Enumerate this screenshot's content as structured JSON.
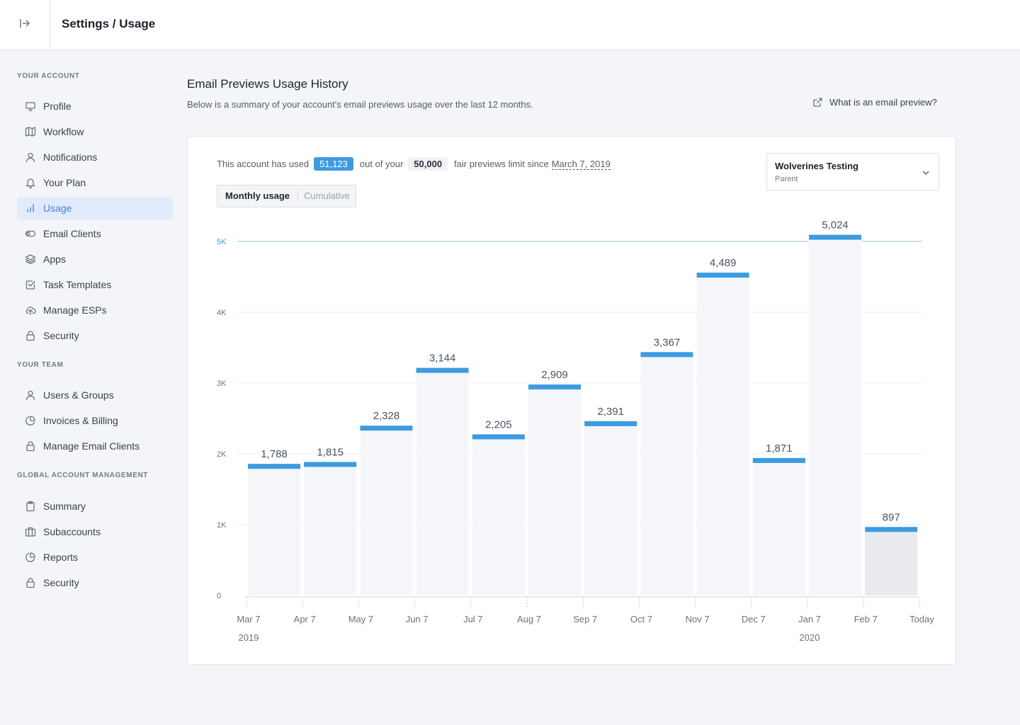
{
  "header": {
    "breadcrumb": "Settings / Usage"
  },
  "sidebar": {
    "sections": [
      {
        "title": "Your Account",
        "items": [
          {
            "label": "Profile",
            "icon": "monitor-icon"
          },
          {
            "label": "Workflow",
            "icon": "map-icon"
          },
          {
            "label": "Notifications",
            "icon": "user-icon"
          },
          {
            "label": "Your Plan",
            "icon": "bell-icon"
          },
          {
            "label": "Usage",
            "icon": "bar-chart-icon",
            "active": true
          },
          {
            "label": "Email Clients",
            "icon": "toggle-icon"
          },
          {
            "label": "Apps",
            "icon": "layers-icon"
          },
          {
            "label": "Task Templates",
            "icon": "checkbox-icon"
          },
          {
            "label": "Manage ESPs",
            "icon": "cloud-upload-icon"
          },
          {
            "label": "Security",
            "icon": "lock-icon"
          }
        ]
      },
      {
        "title": "Your Team",
        "items": [
          {
            "label": "Users & Groups",
            "icon": "user-icon"
          },
          {
            "label": "Invoices & Billing",
            "icon": "pie-chart-icon"
          },
          {
            "label": "Manage Email Clients",
            "icon": "lock-icon"
          }
        ]
      },
      {
        "title": "Global Account Management",
        "items": [
          {
            "label": "Summary",
            "icon": "clipboard-icon"
          },
          {
            "label": "Subaccounts",
            "icon": "briefcase-icon"
          },
          {
            "label": "Reports",
            "icon": "pie-chart-icon"
          },
          {
            "label": "Security",
            "icon": "lock-icon"
          }
        ]
      }
    ]
  },
  "main": {
    "title": "Email Previews Usage History",
    "subtitle": "Below is a summary of your account's email previews usage over the last 12 months.",
    "help_link": "What is an email preview?"
  },
  "summary": {
    "prefix": "This account has used",
    "used": "51,123",
    "middle": "out of your",
    "limit": "50,000",
    "suffix": "fair previews limit since",
    "since": "March 7, 2019"
  },
  "toggle": {
    "monthly": "Monthly usage",
    "cumulative": "Cumulative"
  },
  "account_select": {
    "name": "Wolverines Testing",
    "role": "Parent"
  },
  "colors": {
    "accent": "#3d9be0",
    "bar_fill": "#f5f6f9",
    "current_bar_fill": "#e8eaed",
    "limit_line": "#8cc9e8"
  },
  "chart_data": {
    "type": "bar",
    "categories": [
      "Mar 7",
      "Apr 7",
      "May 7",
      "Jun 7",
      "Jul 7",
      "Aug 7",
      "Sep 7",
      "Oct 7",
      "Nov 7",
      "Dec 7",
      "Jan 7",
      "Feb 7"
    ],
    "x_tick_labels": [
      "Mar 7",
      "Apr 7",
      "May 7",
      "Jun 7",
      "Jul 7",
      "Aug 7",
      "Sep 7",
      "Oct 7",
      "Nov 7",
      "Dec 7",
      "Jan 7",
      "Feb 7",
      "Today"
    ],
    "year_labels": [
      {
        "at": "Mar 7",
        "label": "2019"
      },
      {
        "at": "Jan 7",
        "label": "2020"
      }
    ],
    "values": [
      1788,
      1815,
      2328,
      3144,
      2205,
      2909,
      2391,
      3367,
      4489,
      1871,
      5024,
      897
    ],
    "value_labels": [
      "1,788",
      "1,815",
      "2,328",
      "3,144",
      "2,205",
      "2,909",
      "2,391",
      "3,367",
      "4,489",
      "1,871",
      "5,024",
      "897"
    ],
    "y_ticks": [
      0,
      1000,
      2000,
      3000,
      4000,
      5000
    ],
    "y_tick_labels": [
      "0",
      "1K",
      "2K",
      "3K",
      "4K",
      "5K"
    ],
    "ylim": [
      0,
      5000
    ],
    "limit_value": 5000,
    "grid": true,
    "legend": "none"
  }
}
